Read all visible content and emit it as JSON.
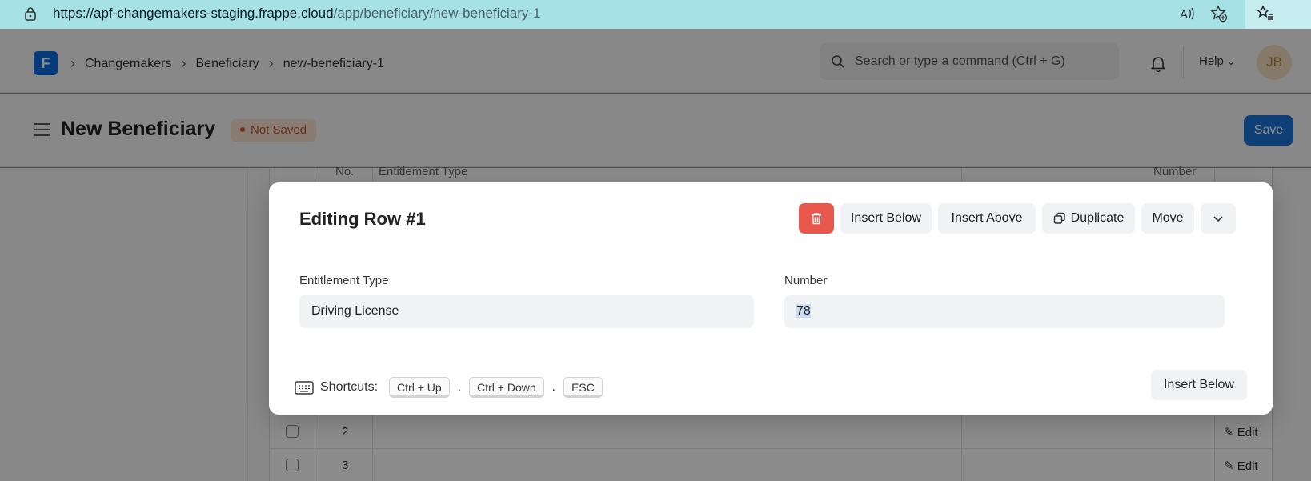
{
  "browser": {
    "url_host": "https://apf-changemakers-staging.frappe.cloud",
    "url_path": "/app/beneficiary/new-beneficiary-1"
  },
  "navbar": {
    "logo_letter": "F",
    "breadcrumbs": [
      "Changemakers",
      "Beneficiary",
      "new-beneficiary-1"
    ],
    "search_placeholder": "Search or type a command (Ctrl + G)",
    "help_label": "Help",
    "avatar_initials": "JB"
  },
  "page": {
    "title": "New Beneficiary",
    "status_badge": "Not Saved",
    "save_label": "Save"
  },
  "grid": {
    "headers": [
      "No.",
      "Entitlement Type",
      "Number"
    ],
    "rows": [
      {
        "idx": "2",
        "edit_label": "Edit"
      },
      {
        "idx": "3",
        "edit_label": "Edit"
      }
    ]
  },
  "modal": {
    "title": "Editing Row #1",
    "buttons": {
      "insert_below": "Insert Below",
      "insert_above": "Insert Above",
      "duplicate": "Duplicate",
      "move": "Move"
    },
    "fields": {
      "entitlement_type_label": "Entitlement Type",
      "entitlement_type_value": "Driving License",
      "number_label": "Number",
      "number_value": "78"
    },
    "shortcuts": {
      "label": "Shortcuts:",
      "keys": [
        "Ctrl + Up",
        "Ctrl + Down",
        "ESC"
      ]
    },
    "footer_insert_below": "Insert Below"
  },
  "colors": {
    "url_bar": "#a6e1e6",
    "primary": "#1a73d9",
    "danger": "#e8574c",
    "badge_bg": "#fae3d2",
    "badge_text": "#c0542c"
  }
}
